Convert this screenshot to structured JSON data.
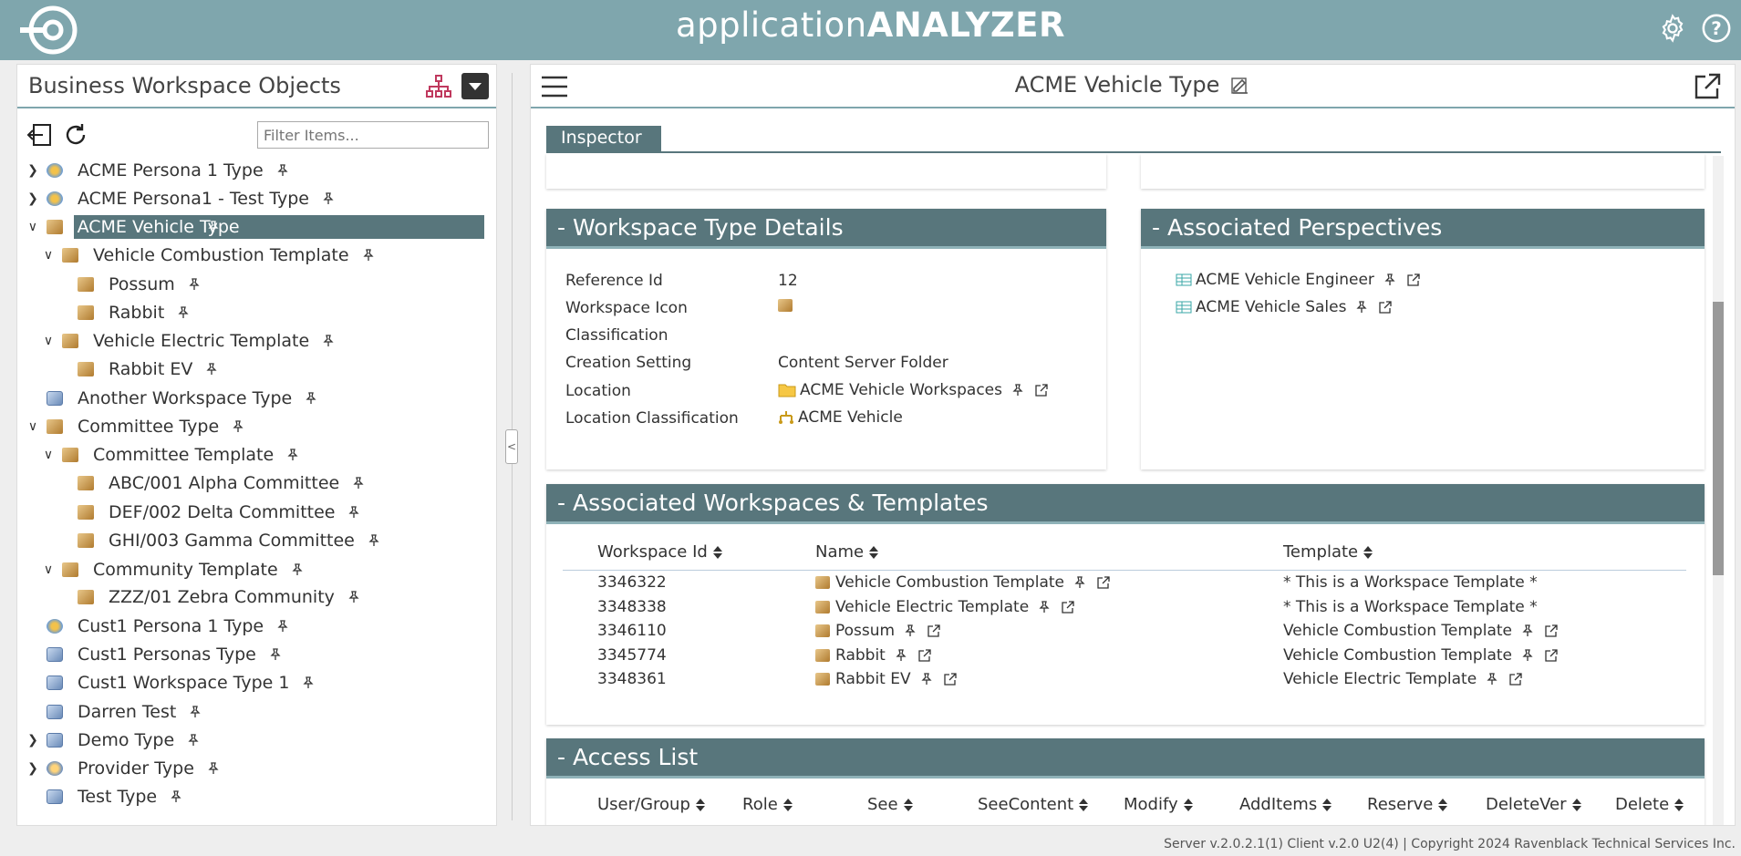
{
  "app": {
    "title_light": "application",
    "title_bold": "ANALYZER"
  },
  "left_panel": {
    "title": "Business Workspace Objects",
    "filter_placeholder": "Filter Items...",
    "tree": [
      {
        "label": "ACME Persona 1 Type",
        "toggle": ">",
        "icon": "persona-icon",
        "level": 0
      },
      {
        "label": "ACME Persona1 - Test Type",
        "toggle": ">",
        "icon": "persona-icon",
        "level": 0
      },
      {
        "label": "ACME Vehicle Type",
        "toggle": "v",
        "icon": "box-icon",
        "level": 0,
        "selected": true
      },
      {
        "label": "Vehicle Combustion Template",
        "toggle": "v",
        "icon": "box-icon",
        "level": 1
      },
      {
        "label": "Possum",
        "toggle": "",
        "icon": "box-icon",
        "level": 2
      },
      {
        "label": "Rabbit",
        "toggle": "",
        "icon": "box-icon",
        "level": 2
      },
      {
        "label": "Vehicle Electric Template",
        "toggle": "v",
        "icon": "box-icon",
        "level": 1
      },
      {
        "label": "Rabbit EV",
        "toggle": "",
        "icon": "box-icon",
        "level": 2
      },
      {
        "label": "Another Workspace Type",
        "toggle": "",
        "icon": "workspace-icon",
        "level": 0
      },
      {
        "label": "Committee Type",
        "toggle": "v",
        "icon": "box-icon",
        "level": 0
      },
      {
        "label": "Committee Template",
        "toggle": "v",
        "icon": "box-icon",
        "level": 1
      },
      {
        "label": "ABC/001 Alpha Committee",
        "toggle": "",
        "icon": "box-icon",
        "level": 2
      },
      {
        "label": "DEF/002 Delta Committee",
        "toggle": "",
        "icon": "box-icon",
        "level": 2
      },
      {
        "label": "GHI/003 Gamma Committee",
        "toggle": "",
        "icon": "box-icon",
        "level": 2
      },
      {
        "label": "Community Template",
        "toggle": "v",
        "icon": "box-icon",
        "level": 1
      },
      {
        "label": "ZZZ/01 Zebra Community",
        "toggle": "",
        "icon": "box-icon",
        "level": 2
      },
      {
        "label": "Cust1 Persona 1 Type",
        "toggle": "",
        "icon": "persona-icon",
        "level": 0
      },
      {
        "label": "Cust1 Personas Type",
        "toggle": "",
        "icon": "workspace-icon",
        "level": 0
      },
      {
        "label": "Cust1 Workspace Type 1",
        "toggle": "",
        "icon": "workspace-icon",
        "level": 0
      },
      {
        "label": "Darren Test",
        "toggle": "",
        "icon": "workspace-icon",
        "level": 0
      },
      {
        "label": "Demo Type",
        "toggle": ">",
        "icon": "workspace-icon",
        "level": 0
      },
      {
        "label": "Provider Type",
        "toggle": ">",
        "icon": "provider-icon",
        "level": 0
      },
      {
        "label": "Test Type",
        "toggle": "",
        "icon": "workspace-icon",
        "level": 0
      }
    ]
  },
  "right_panel": {
    "title": "ACME Vehicle Type",
    "tab": "Inspector",
    "details": {
      "header": "- Workspace Type Details",
      "rows": [
        {
          "key": "Reference Id",
          "value": "12"
        },
        {
          "key": "Workspace Icon",
          "value": ""
        },
        {
          "key": "Classification",
          "value": ""
        },
        {
          "key": "Creation Setting",
          "value": "Content Server Folder"
        },
        {
          "key": "Location",
          "value": "ACME Vehicle Workspaces"
        },
        {
          "key": "Location Classification",
          "value": "ACME Vehicle"
        }
      ]
    },
    "perspectives": {
      "header": "- Associated Perspectives",
      "items": [
        "ACME Vehicle Engineer",
        "ACME Vehicle Sales"
      ]
    },
    "workspaces": {
      "header": "- Associated Workspaces & Templates",
      "columns": [
        "Workspace Id",
        "Name",
        "Template"
      ],
      "rows": [
        {
          "id": "3346322",
          "name": "Vehicle Combustion Template",
          "template": "* This is a Workspace Template *"
        },
        {
          "id": "3348338",
          "name": "Vehicle Electric Template",
          "template": "* This is a Workspace Template *"
        },
        {
          "id": "3346110",
          "name": "Possum",
          "template": "Vehicle Combustion Template"
        },
        {
          "id": "3345774",
          "name": "Rabbit",
          "template": "Vehicle Combustion Template"
        },
        {
          "id": "3348361",
          "name": "Rabbit EV",
          "template": "Vehicle Electric Template"
        }
      ]
    },
    "access": {
      "header": "- Access List",
      "columns": [
        "User/Group",
        "Role",
        "See",
        "SeeContent",
        "Modify",
        "AddItems",
        "Reserve",
        "DeleteVer",
        "Delete"
      ]
    }
  },
  "footer": "Server v.2.0.2.1(1) Client v.2.0 U2(4) | Copyright 2024 Ravenblack Technical Services Inc."
}
